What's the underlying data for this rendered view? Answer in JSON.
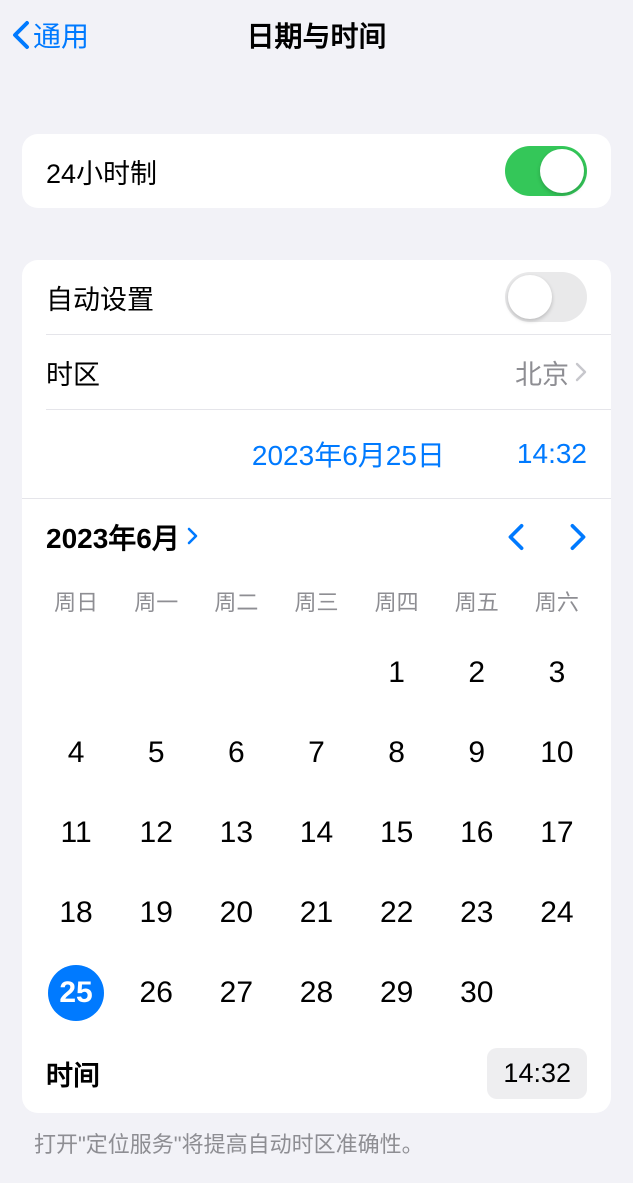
{
  "header": {
    "back_label": "通用",
    "title": "日期与时间"
  },
  "settings": {
    "twenty_four_hour_label": "24小时制",
    "twenty_four_hour_on": true,
    "auto_set_label": "自动设置",
    "auto_set_on": false,
    "timezone_label": "时区",
    "timezone_value": "北京"
  },
  "selected": {
    "date_display": "2023年6月25日",
    "time_display": "14:32"
  },
  "calendar": {
    "month_year": "2023年6月",
    "weekdays": [
      "周日",
      "周一",
      "周二",
      "周三",
      "周四",
      "周五",
      "周六"
    ],
    "first_weekday_index": 4,
    "days_in_month": 30,
    "selected_day": 25,
    "time_label": "时间",
    "time_value": "14:32"
  },
  "footer": {
    "note": "打开\"定位服务\"将提高自动时区准确性。"
  }
}
